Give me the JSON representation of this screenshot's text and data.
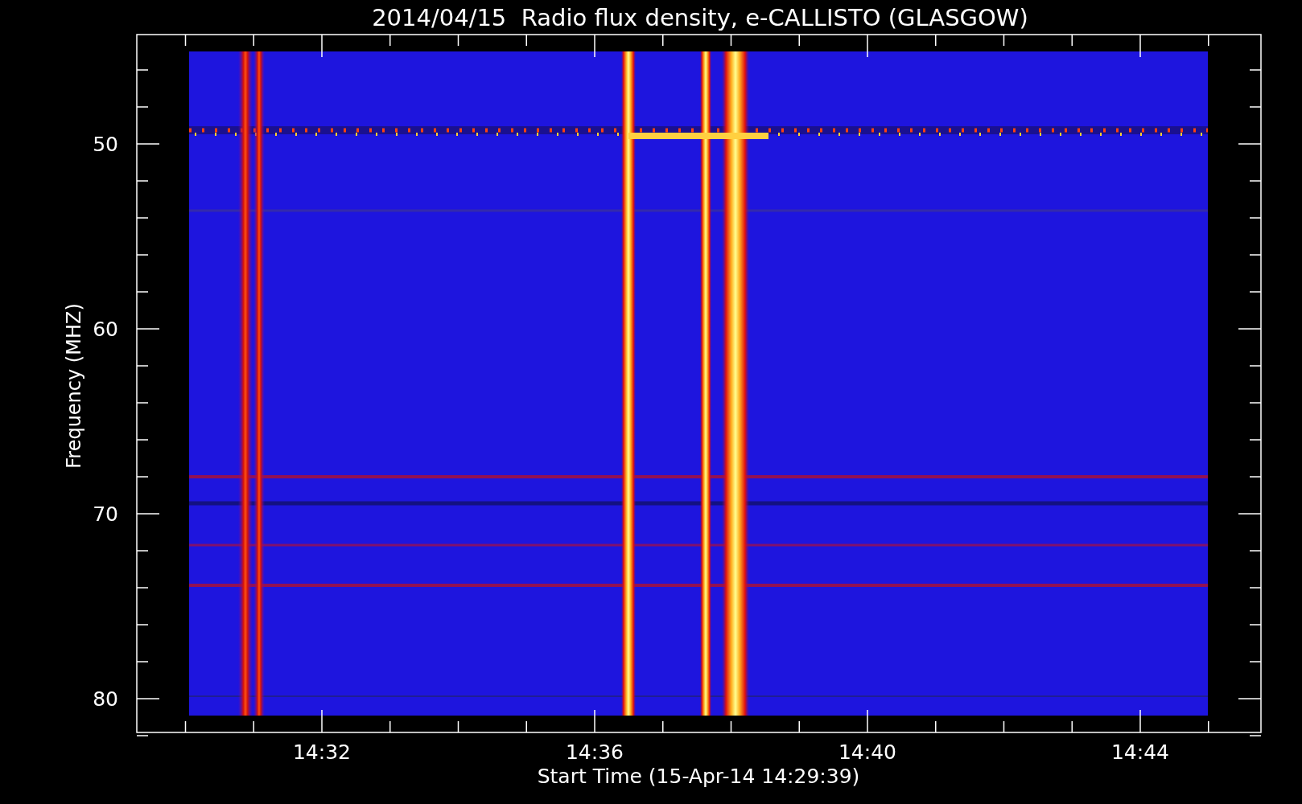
{
  "title": "2014/04/15  Radio flux density, e-CALLISTO (GLASGOW)",
  "ylabel": "Frequency (MHZ)",
  "xlabel": "Start Time (15-Apr-14 14:29:39)",
  "yticks": [
    "50",
    "60",
    "70",
    "80"
  ],
  "xticks": [
    "14:32",
    "14:36",
    "14:40",
    "14:44"
  ]
}
